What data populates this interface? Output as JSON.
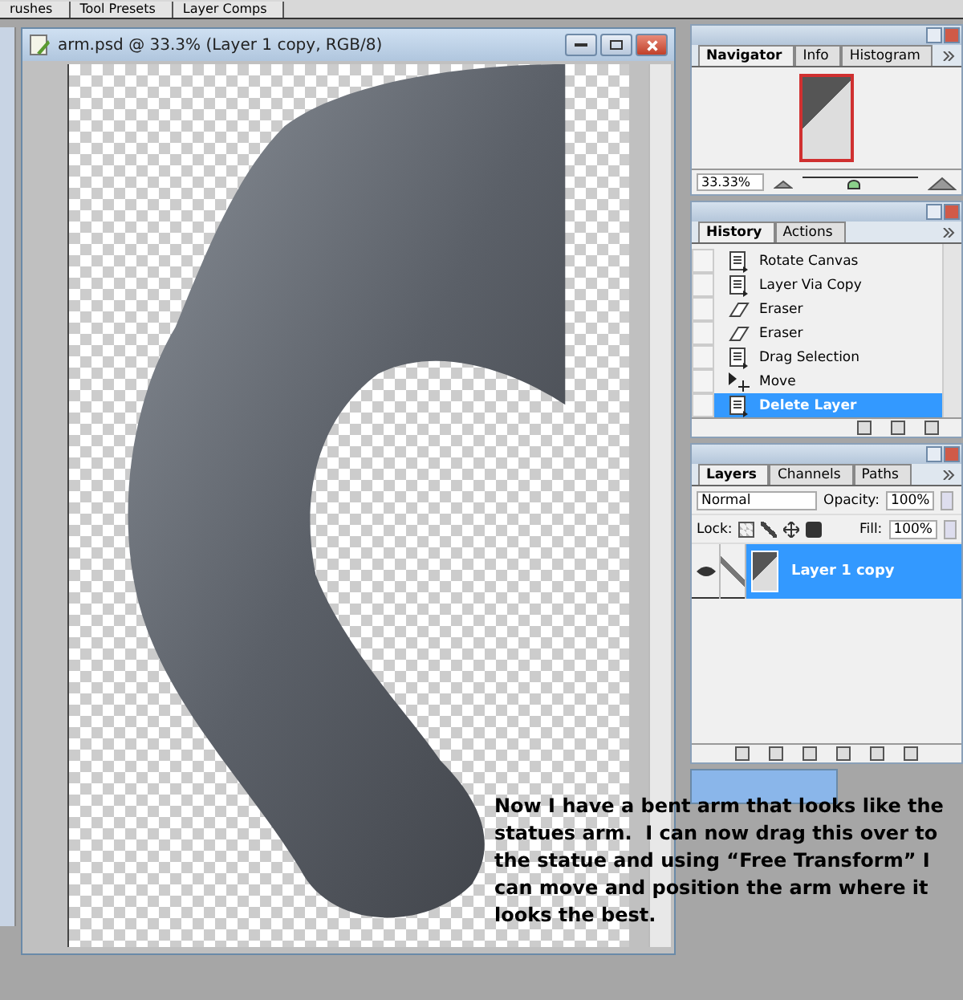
{
  "top_tabs": [
    {
      "label": "rushes"
    },
    {
      "label": "Tool Presets"
    },
    {
      "label": "Layer Comps"
    }
  ],
  "document": {
    "title": "arm.psd @ 33.3% (Layer 1 copy, RGB/8)"
  },
  "navigator": {
    "tabs": [
      {
        "label": "Navigator",
        "selected": true
      },
      {
        "label": "Info",
        "selected": false
      },
      {
        "label": "Histogram",
        "selected": false
      }
    ],
    "zoom": "33.33%",
    "zoom_slider": {
      "level": 0.45
    }
  },
  "history": {
    "tabs": [
      {
        "label": "History",
        "selected": true
      },
      {
        "label": "Actions",
        "selected": false
      }
    ],
    "items": [
      {
        "label": "Rotate Canvas",
        "kind": "document",
        "selected": false
      },
      {
        "label": "Layer Via Copy",
        "kind": "document",
        "selected": false
      },
      {
        "label": "Eraser",
        "kind": "eraser",
        "selected": false
      },
      {
        "label": "Eraser",
        "kind": "eraser",
        "selected": false
      },
      {
        "label": "Drag Selection",
        "kind": "document",
        "selected": false
      },
      {
        "label": "Move",
        "kind": "move",
        "selected": false
      },
      {
        "label": "Delete Layer",
        "kind": "document",
        "selected": true
      }
    ]
  },
  "layers": {
    "tabs": [
      {
        "label": "Layers",
        "selected": true
      },
      {
        "label": "Channels",
        "selected": false
      },
      {
        "label": "Paths",
        "selected": false
      }
    ],
    "blend_mode": "Normal",
    "opacity_label": "Opacity:",
    "opacity": "100%",
    "lock_label": "Lock:",
    "fill_label": "Fill:",
    "fill": "100%",
    "items": [
      {
        "name": "Layer 1 copy",
        "visible": true,
        "selected": true
      }
    ]
  },
  "caption": "Now I have a bent arm that looks like the statues arm.  I can now drag this over to the statue and using “Free Transform” I can move and position the arm where it looks the best."
}
